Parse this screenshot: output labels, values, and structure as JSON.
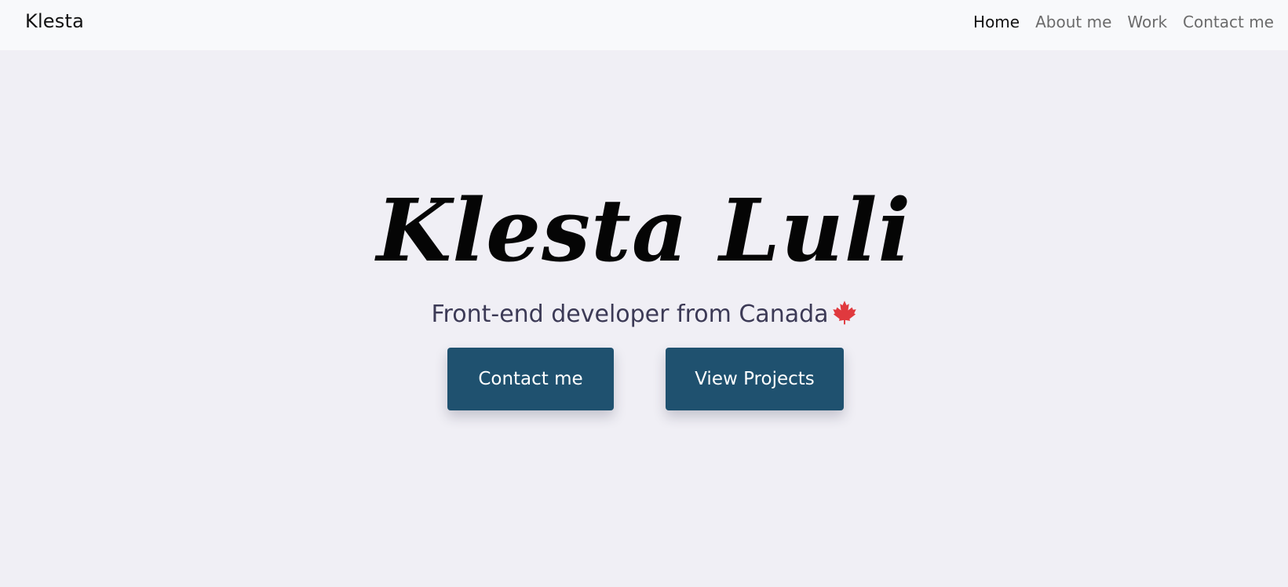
{
  "navbar": {
    "brand": "Klesta",
    "links": [
      {
        "label": "Home",
        "active": true
      },
      {
        "label": "About me",
        "active": false
      },
      {
        "label": "Work",
        "active": false
      },
      {
        "label": "Contact me",
        "active": false
      }
    ]
  },
  "hero": {
    "title": "Klesta Luli",
    "subtitle": "Front-end developer from Canada",
    "flag_icon": "maple-leaf-icon",
    "buttons": {
      "contact_label": "Contact me",
      "projects_label": "View Projects"
    }
  },
  "colors": {
    "page_background": "#f0eff5",
    "navbar_background": "#f8f9fb",
    "button_background": "#1f516f",
    "subtitle_text": "#3c3a56",
    "maple_leaf": "#e0393e"
  }
}
